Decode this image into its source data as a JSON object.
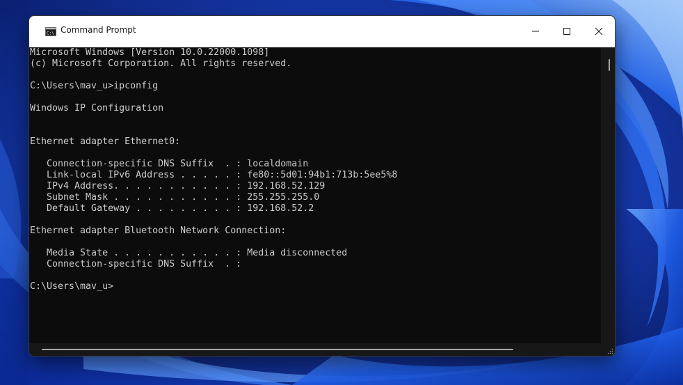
{
  "window": {
    "title": "Command Prompt",
    "icon": "command-prompt-icon",
    "controls": {
      "minimize": "minimize-icon",
      "maximize": "maximize-icon",
      "close": "close-icon"
    }
  },
  "console": {
    "lines": [
      "Microsoft Windows [Version 10.0.22000.1098]",
      "(c) Microsoft Corporation. All rights reserved.",
      "",
      "C:\\Users\\mav_u>ipconfig",
      "",
      "Windows IP Configuration",
      "",
      "",
      "Ethernet adapter Ethernet0:",
      "",
      "   Connection-specific DNS Suffix  . : localdomain",
      "   Link-local IPv6 Address . . . . . : fe80::5d01:94b1:713b:5ee5%8",
      "   IPv4 Address. . . . . . . . . . . : 192.168.52.129",
      "   Subnet Mask . . . . . . . . . . . : 255.255.255.0",
      "   Default Gateway . . . . . . . . . : 192.168.52.2",
      "",
      "Ethernet adapter Bluetooth Network Connection:",
      "",
      "   Media State . . . . . . . . . . . : Media disconnected",
      "   Connection-specific DNS Suffix  . :",
      "",
      "C:\\Users\\mav_u>"
    ]
  },
  "colors": {
    "console_background": "#0c0c0c",
    "console_text": "#cccccc",
    "titlebar": "#ffffff",
    "wallpaper_base": "#0a1f73",
    "wallpaper_bloom": "#1f5ee8"
  }
}
